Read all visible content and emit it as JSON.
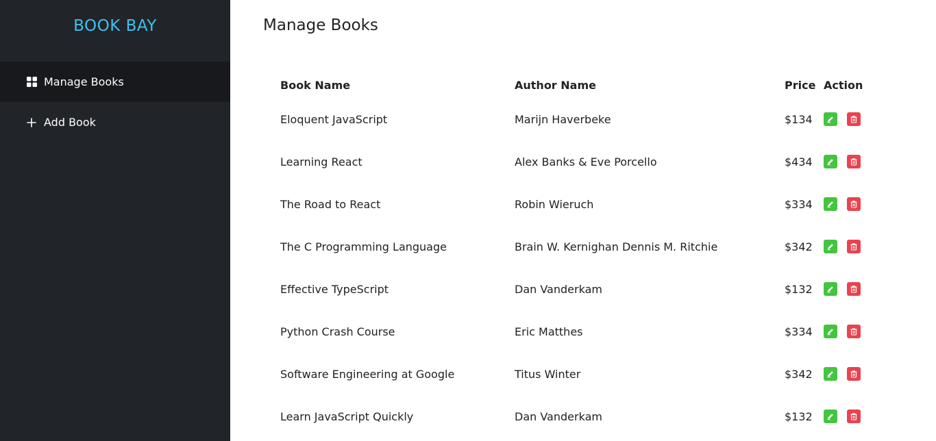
{
  "brand": "BOOK BAY",
  "sidebar": {
    "items": [
      {
        "label": "Manage Books",
        "icon": "grid-icon",
        "active": true
      },
      {
        "label": "Add Book",
        "icon": "plus-icon",
        "active": false
      }
    ]
  },
  "main": {
    "title": "Manage Books",
    "table": {
      "headers": {
        "book": "Book Name",
        "author": "Author Name",
        "price": "Price",
        "action": "Action"
      },
      "rows": [
        {
          "book": "Eloquent JavaScript",
          "author": "Marijn Haverbeke",
          "price": "$134"
        },
        {
          "book": "Learning React",
          "author": "Alex Banks & Eve Porcello",
          "price": "$434"
        },
        {
          "book": "The Road to React",
          "author": "Robin Wieruch",
          "price": "$334"
        },
        {
          "book": "The C Programming Language",
          "author": "Brain W. Kernighan Dennis M. Ritchie",
          "price": "$342"
        },
        {
          "book": "Effective TypeScript",
          "author": "Dan Vanderkam",
          "price": "$132"
        },
        {
          "book": "Python Crash Course",
          "author": "Eric Matthes",
          "price": "$334"
        },
        {
          "book": "Software Engineering at Google",
          "author": "Titus Winter",
          "price": "$342"
        },
        {
          "book": "Learn JavaScript Quickly",
          "author": "Dan Vanderkam",
          "price": "$132"
        }
      ]
    }
  },
  "colors": {
    "sidebar_bg": "#212428",
    "active_bg": "#17191c",
    "brand": "#3ec1ee",
    "edit": "#45c43f",
    "delete": "#e8434e"
  }
}
